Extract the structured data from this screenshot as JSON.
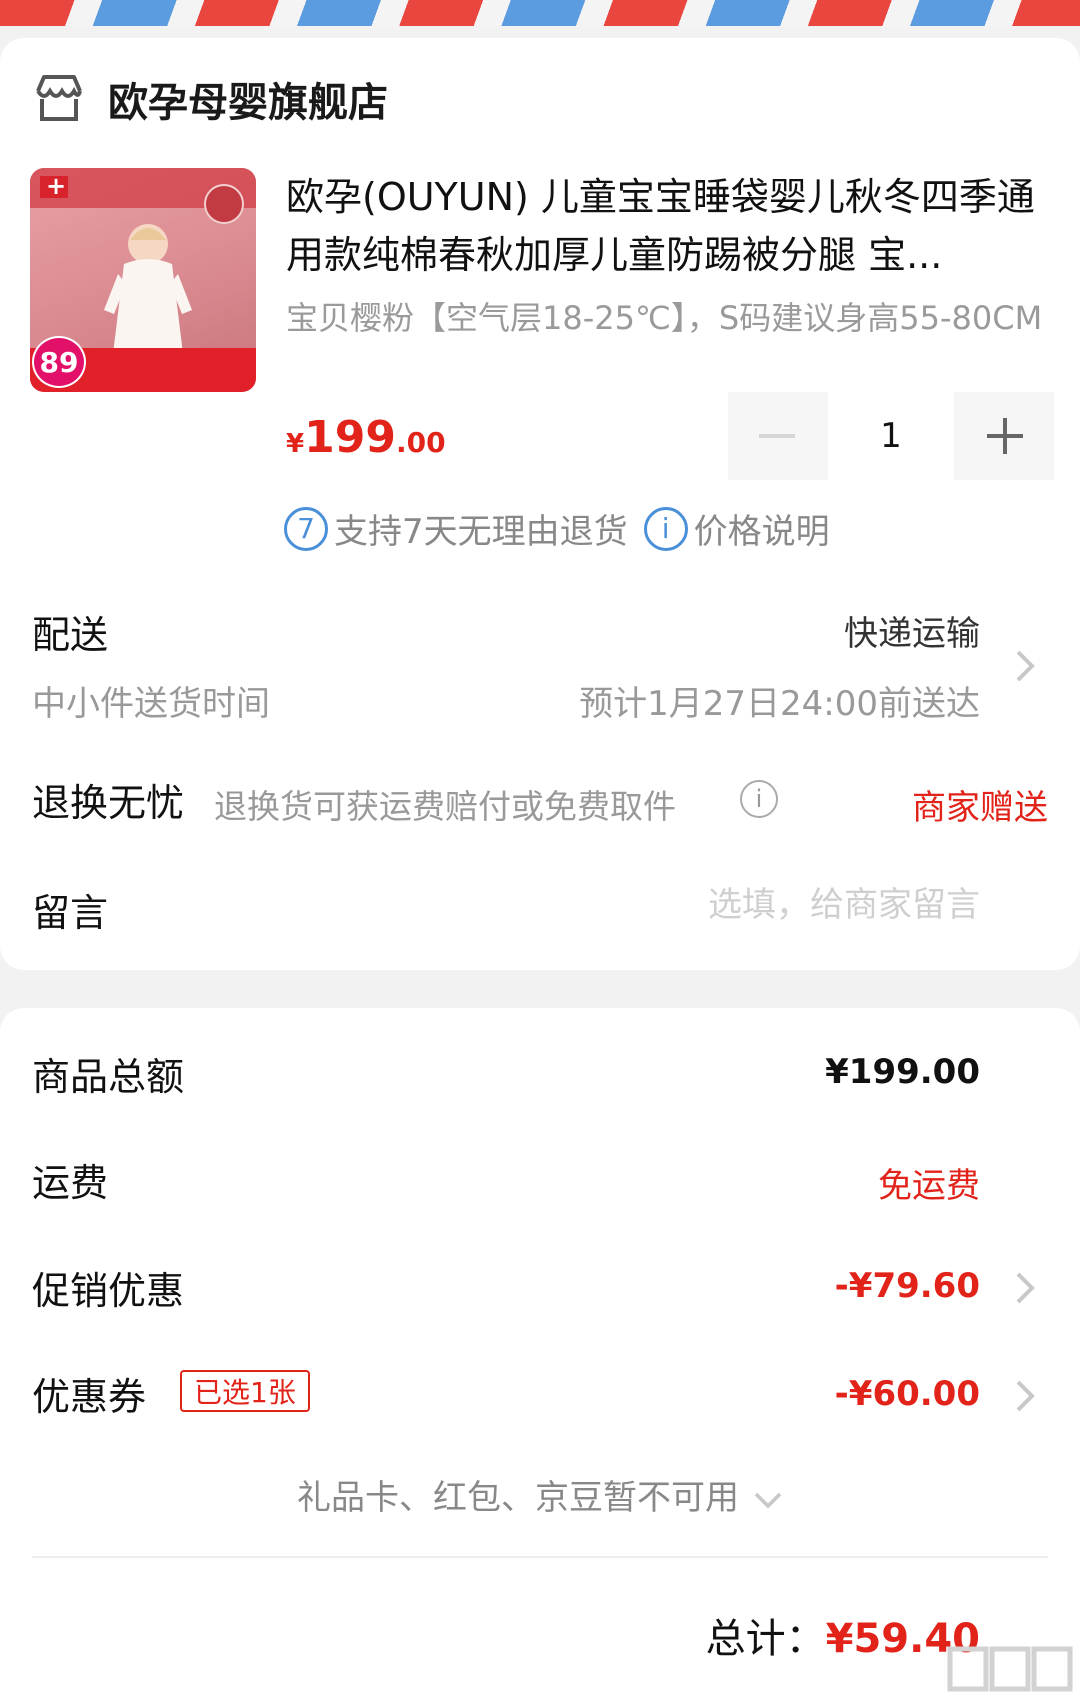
{
  "store": {
    "name": "欧孕母婴旗舰店"
  },
  "product": {
    "title": "欧孕(OUYUN) 儿童宝宝睡袋婴儿秋冬四季通用款纯棉春秋加厚儿童防踢被分腿 宝...",
    "spec": "宝贝樱粉【空气层18-25℃】，S码建议身高55-80CM",
    "price_symbol": "¥",
    "price_integer": "199",
    "price_decimal": ".00",
    "quantity": "1",
    "thumb_badge_price": "89",
    "services": [
      {
        "icon_text": "7",
        "label": "支持7天无理由退货",
        "icon": "seven-day-return-icon"
      },
      {
        "icon_text": "i",
        "label": "价格说明",
        "icon": "info-icon"
      }
    ]
  },
  "delivery": {
    "label": "配送",
    "mode": "快递运输",
    "sub_label": "中小件送货时间",
    "eta": "预计1月27日24:00前送达"
  },
  "returns": {
    "label": "退换无忧",
    "description": "退换货可获运费赔付或免费取件",
    "badge": "商家赠送"
  },
  "message": {
    "label": "留言",
    "placeholder": "选填，给商家留言"
  },
  "summary": {
    "goods_total_label": "商品总额",
    "goods_total_value": "¥199.00",
    "shipping_label": "运费",
    "shipping_value": "免运费",
    "promo_label": "促销优惠",
    "promo_value": "-¥79.60",
    "coupon_label": "优惠券",
    "coupon_tag": "已选1张",
    "coupon_value": "-¥60.00",
    "gift_note": "礼品卡、红包、京豆暂不可用"
  },
  "total": {
    "label": "总计：",
    "amount": "¥59.40"
  },
  "colors": {
    "accent_red": "#e2231a",
    "service_blue": "#4a90d9"
  }
}
